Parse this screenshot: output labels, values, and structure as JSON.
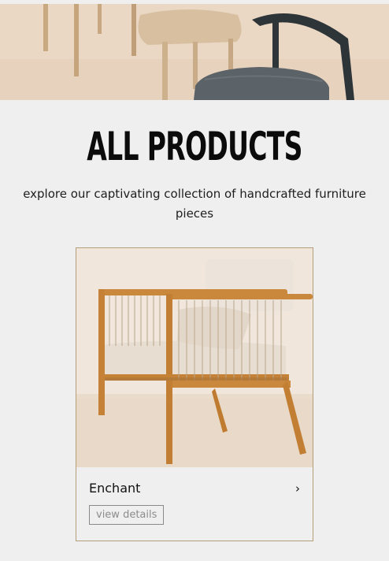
{
  "hero": {
    "image_alt": "chairs"
  },
  "page": {
    "title": "ALL PRODUCTS",
    "subtitle": "explore our captivating collection of handcrafted furniture pieces"
  },
  "products": [
    {
      "name": "Enchant",
      "action_label": "view details",
      "chevron_icon": "chevron-right-icon"
    }
  ]
}
